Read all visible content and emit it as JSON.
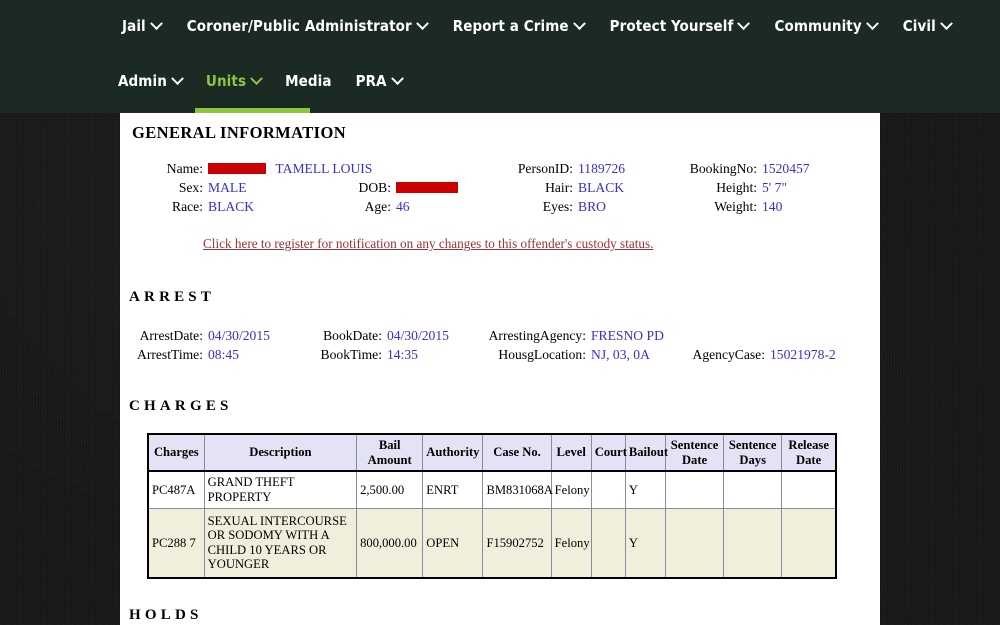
{
  "nav": {
    "primary": [
      {
        "label": "Jail",
        "has_caret": true,
        "active": false
      },
      {
        "label": "Coroner/Public Administrator",
        "has_caret": true,
        "active": false
      },
      {
        "label": "Report a Crime",
        "has_caret": true,
        "active": false
      },
      {
        "label": "Protect Yourself",
        "has_caret": true,
        "active": false
      },
      {
        "label": "Community",
        "has_caret": true,
        "active": false
      },
      {
        "label": "Civil",
        "has_caret": true,
        "active": false
      }
    ],
    "secondary": [
      {
        "label": "Admin",
        "has_caret": true,
        "active": false
      },
      {
        "label": "Units",
        "has_caret": true,
        "active": true
      },
      {
        "label": "Media",
        "has_caret": false,
        "active": false
      },
      {
        "label": "PRA",
        "has_caret": true,
        "active": false
      }
    ],
    "accent_color": "#8cc63f",
    "background_color": "#1b2a23"
  },
  "sections": {
    "general_information_title": "GENERAL INFORMATION",
    "arrest_title": "ARREST",
    "charges_title": "CHARGES",
    "holds_title": "HOLDS"
  },
  "general_information": {
    "name_label": "Name:",
    "name_value": "TAMELL LOUIS",
    "name_redacted": true,
    "sex_label": "Sex:",
    "sex_value": "MALE",
    "race_label": "Race:",
    "race_value": "BLACK",
    "dob_label": "DOB:",
    "dob_value": "",
    "dob_redacted": true,
    "age_label": "Age:",
    "age_value": "46",
    "personid_label": "PersonID:",
    "personid_value": "1189726",
    "hair_label": "Hair:",
    "hair_value": "BLACK",
    "eyes_label": "Eyes:",
    "eyes_value": "BRO",
    "bookingno_label": "BookingNo:",
    "bookingno_value": "1520457",
    "height_label": "Height:",
    "height_value": "5' 7\"",
    "weight_label": "Weight:",
    "weight_value": "140",
    "notify_link": "Click here to register for notification on any changes to this offender's custody status."
  },
  "arrest": {
    "arrestdate_label": "ArrestDate:",
    "arrestdate_value": "04/30/2015",
    "arresttime_label": "ArrestTime:",
    "arresttime_value": "08:45",
    "bookdate_label": "BookDate:",
    "bookdate_value": "04/30/2015",
    "booktime_label": "BookTime:",
    "booktime_value": "14:35",
    "arrestingagency_label": "ArrestingAgency:",
    "arrestingagency_value": "FRESNO PD",
    "housglocation_label": "HousgLocation:",
    "housglocation_value": "NJ, 03, 0A",
    "agencycase_label": "AgencyCase:",
    "agencycase_value": "15021978-2"
  },
  "charges_table": {
    "headers": [
      "Charges",
      "Description",
      "Bail Amount",
      "Authority",
      "Case No.",
      "Level",
      "Court",
      "Bailout",
      "Sentence Date",
      "Sentence Days",
      "Release Date"
    ],
    "header_lines": {
      "bail": [
        "Bail",
        "Amount"
      ],
      "sentence_date": [
        "Sentence",
        "Date"
      ],
      "sentence_days": [
        "Sentence",
        "Days"
      ],
      "release_date": [
        "Release",
        "Date"
      ]
    },
    "rows": [
      {
        "charges": "PC487A",
        "description": "GRAND THEFT PROPERTY",
        "bail_amount": "2,500.00",
        "authority": "ENRT",
        "case_no": "BM831068A",
        "level": "Felony",
        "court": "",
        "bailout": "Y",
        "sentence_date": "",
        "sentence_days": "",
        "release_date": ""
      },
      {
        "charges": "PC288 7",
        "description": "SEXUAL INTERCOURSE OR SODOMY WITH A CHILD 10 YEARS OR YOUNGER",
        "bail_amount": "800,000.00",
        "authority": "OPEN",
        "case_no": "F15902752",
        "level": "Felony",
        "court": "",
        "bailout": "Y",
        "sentence_date": "",
        "sentence_days": "",
        "release_date": ""
      }
    ]
  },
  "colors": {
    "value_text": "#3333cc",
    "redaction": "#cc0000",
    "link": "#993333",
    "table_header_bg": "#e3e3f5",
    "table_alt_row_bg": "#efefdc"
  }
}
